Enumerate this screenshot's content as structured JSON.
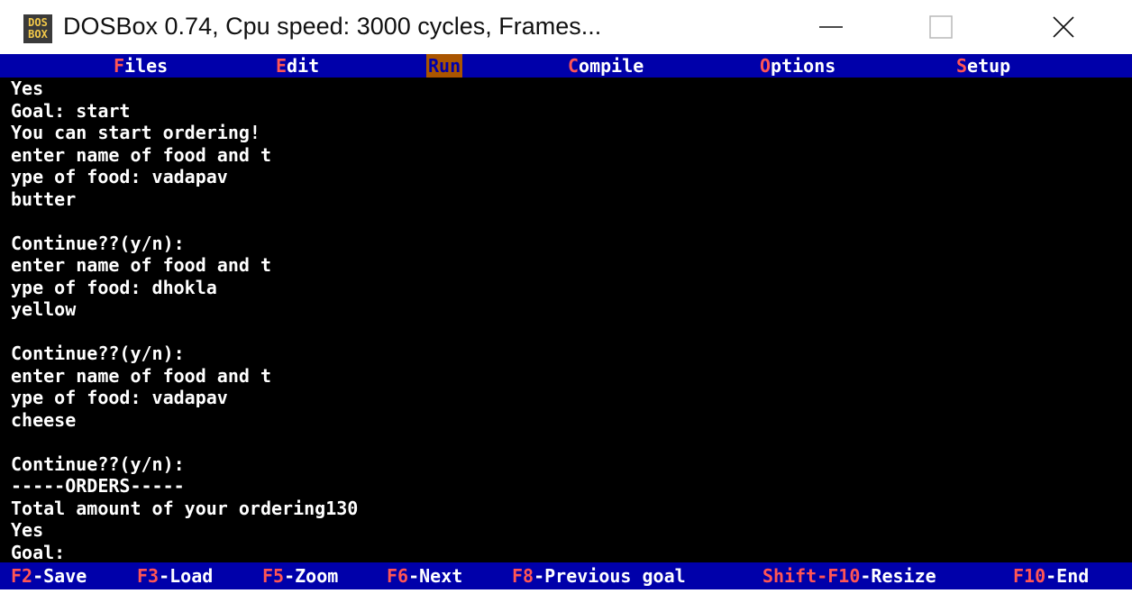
{
  "window": {
    "title": "DOSBox 0.74, Cpu speed:    3000 cycles, Frames...",
    "icon_text_top": "DOS",
    "icon_text_bottom": "BOX"
  },
  "menu": {
    "items": [
      {
        "hotkey": "F",
        "rest": "iles"
      },
      {
        "hotkey": "E",
        "rest": "dit"
      },
      {
        "hotkey": "R",
        "rest": "un"
      },
      {
        "hotkey": "C",
        "rest": "ompile"
      },
      {
        "hotkey": "O",
        "rest": "ptions"
      },
      {
        "hotkey": "S",
        "rest": "etup"
      }
    ],
    "active_index": 2
  },
  "console": {
    "lines": [
      "Yes",
      "Goal: start",
      "You can start ordering!",
      "enter name of food and t",
      "ype of food: vadapav",
      "butter",
      "",
      "Continue??(y/n):",
      "enter name of food and t",
      "ype of food: dhokla",
      "yellow",
      "",
      "Continue??(y/n):",
      "enter name of food and t",
      "ype of food: vadapav",
      "cheese",
      "",
      "Continue??(y/n):",
      "-----ORDERS-----",
      "Total amount of your ordering130",
      "Yes",
      "Goal:"
    ]
  },
  "status": {
    "keys": [
      {
        "key": "F2",
        "label": "-Save"
      },
      {
        "key": "F3",
        "label": "-Load"
      },
      {
        "key": "F5",
        "label": "-Zoom"
      },
      {
        "key": "F6",
        "label": "-Next"
      },
      {
        "key": "F8",
        "label": "-Previous goal"
      },
      {
        "key": "Shift-F10",
        "label": "-Resize"
      },
      {
        "key": "F10",
        "label": "-End"
      }
    ]
  },
  "colors": {
    "menu_bg": "#0000aa",
    "hotkey": "#ff5555",
    "active_menu_bg": "#aa5500",
    "console_bg": "#000000",
    "console_fg": "#ffffff"
  },
  "icons": {
    "minimize": "minimize-icon",
    "maximize": "maximize-icon",
    "close": "close-icon"
  }
}
